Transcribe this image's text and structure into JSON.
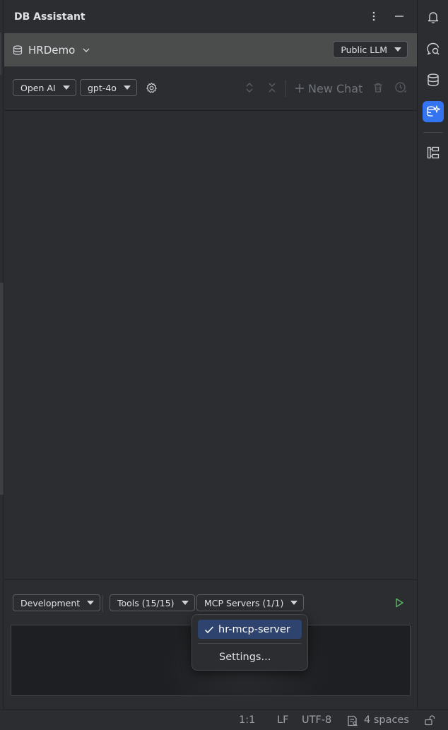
{
  "panel": {
    "title": "DB Assistant",
    "database": "HRDemo",
    "llm_mode": "Public LLM"
  },
  "toolbar": {
    "provider": "Open AI",
    "model": "gpt-4o",
    "new_chat_label": "New Chat"
  },
  "bottom_toolbar": {
    "environment": "Development",
    "tools": "Tools (15/15)",
    "mcp_servers": "MCP Servers (1/1)"
  },
  "mcp_popup": {
    "selected_server": "hr-mcp-server",
    "settings_label": "Settings..."
  },
  "status_bar": {
    "position": "1:1",
    "line_endings": "LF",
    "encoding": "UTF-8",
    "indent": "4 spaces"
  },
  "colors": {
    "background": "#2b2d30",
    "db_bar": "#4b4d4d",
    "accent": "#3574f0",
    "selection": "#2e436e",
    "run_icon": "#5fb865"
  },
  "icons": {
    "title_actions": [
      "more-vertical-icon",
      "minimize-icon"
    ],
    "right_strip": [
      "bell-icon",
      "chat-search-icon",
      "database-icon",
      "db-assistant-icon",
      "structure-icon"
    ]
  }
}
